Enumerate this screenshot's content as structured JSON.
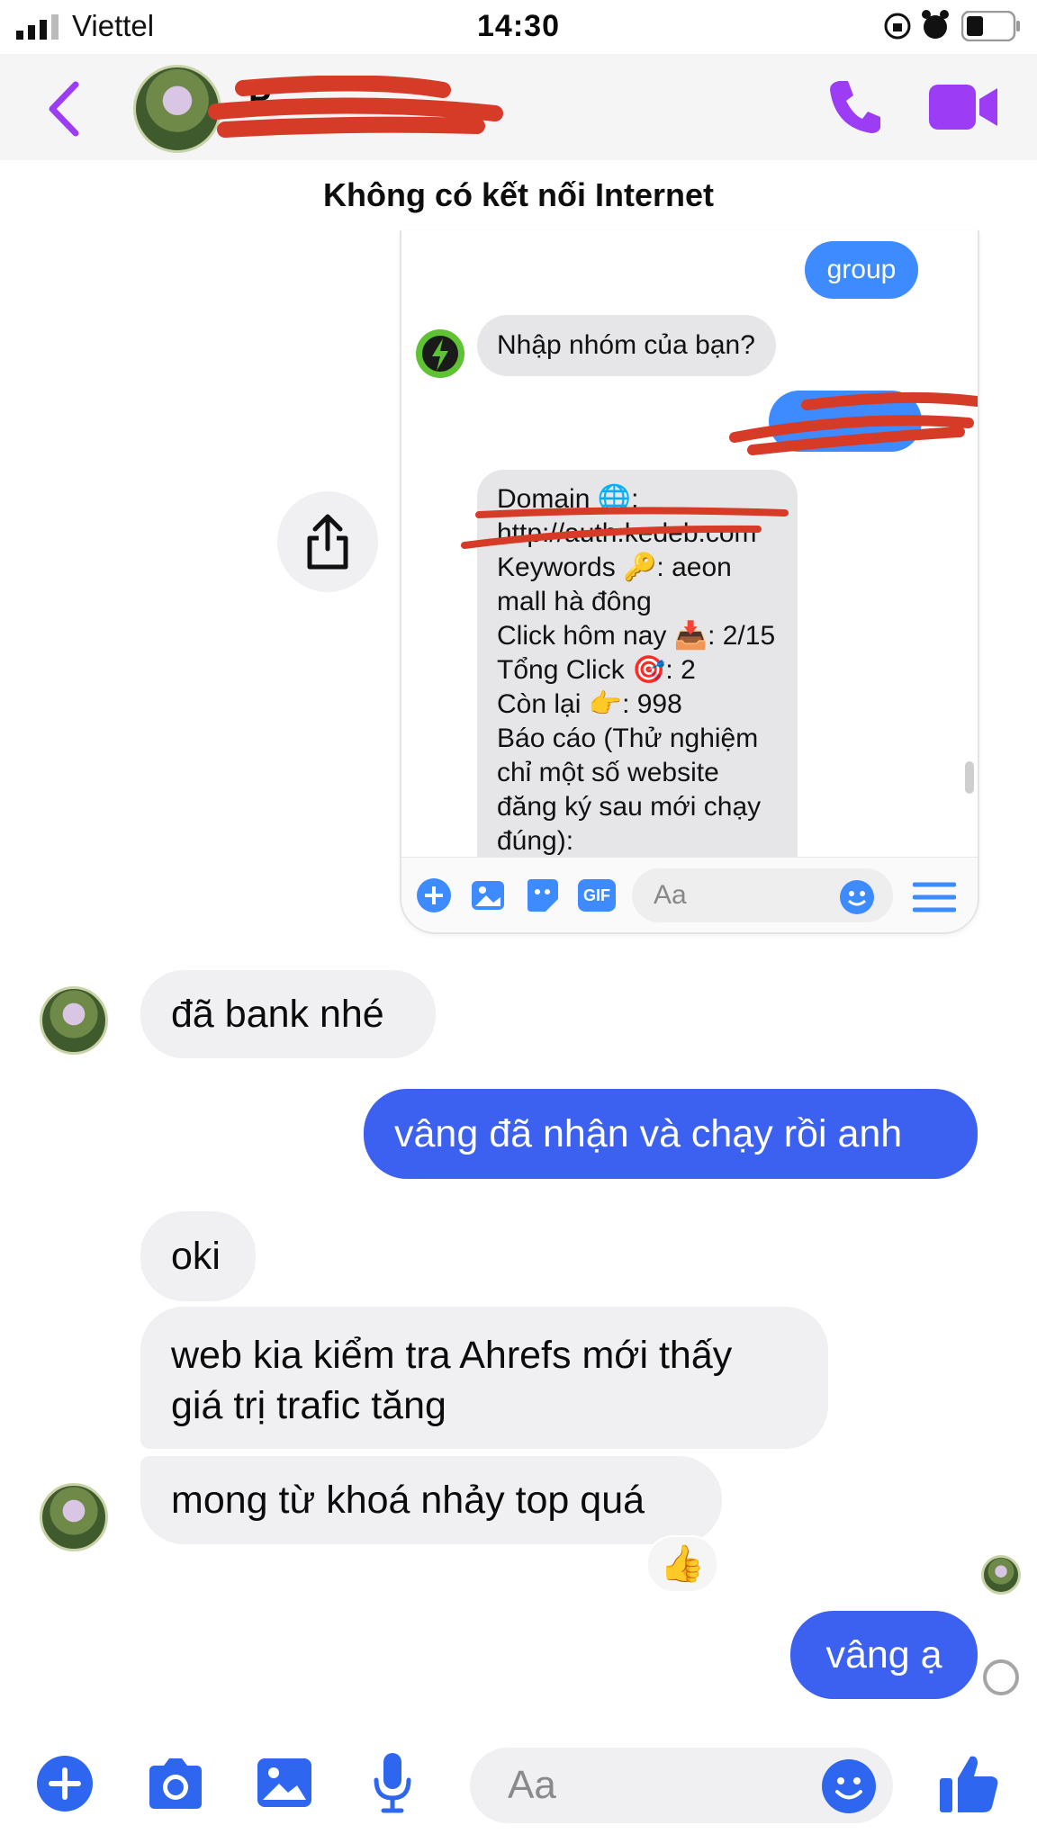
{
  "status_bar": {
    "carrier": "Viettel",
    "time": "14:30"
  },
  "header": {
    "contact_name": "P",
    "back_label": "‹"
  },
  "connection_banner": "Không có kết nối Internet",
  "embedded_screenshot": {
    "bubble_group": "group",
    "bot_prompt": "Nhập nhóm của bạn?",
    "info_lines": [
      "Domain 🌐:",
      "http://auth.kedeb.com",
      "Keywords 🔑: aeon",
      "mall hà đông",
      "Click hôm nay 📥: 2/15",
      "Tổng Click 🎯: 2",
      "Còn lại 👉: 998",
      "Báo cáo (Thử nghiệm",
      "chỉ một số website",
      "đăng ký sau mới chạy",
      "đúng):"
    ],
    "composer_placeholder": "Aa",
    "gif_label": "GIF"
  },
  "messages": [
    {
      "side": "in",
      "text": "đã bank nhé"
    },
    {
      "side": "out",
      "text": "vâng đã nhận và chạy rồi anh"
    },
    {
      "side": "in",
      "text": "oki"
    },
    {
      "side": "in",
      "text": "web kia kiểm tra Ahrefs mới thấy giá trị trafic tăng",
      "line1": "web kia kiểm tra Ahrefs mới thấy",
      "line2": "giá trị trafic tăng"
    },
    {
      "side": "in",
      "text": "mong từ khoá nhảy top quá",
      "reaction": "👍"
    },
    {
      "side": "out",
      "text": "vâng ạ"
    }
  ],
  "composer": {
    "placeholder": "Aa"
  },
  "colors": {
    "accent": "#3c60f0",
    "header_icons": "#9c3cf5",
    "redaction": "#d63b28"
  }
}
